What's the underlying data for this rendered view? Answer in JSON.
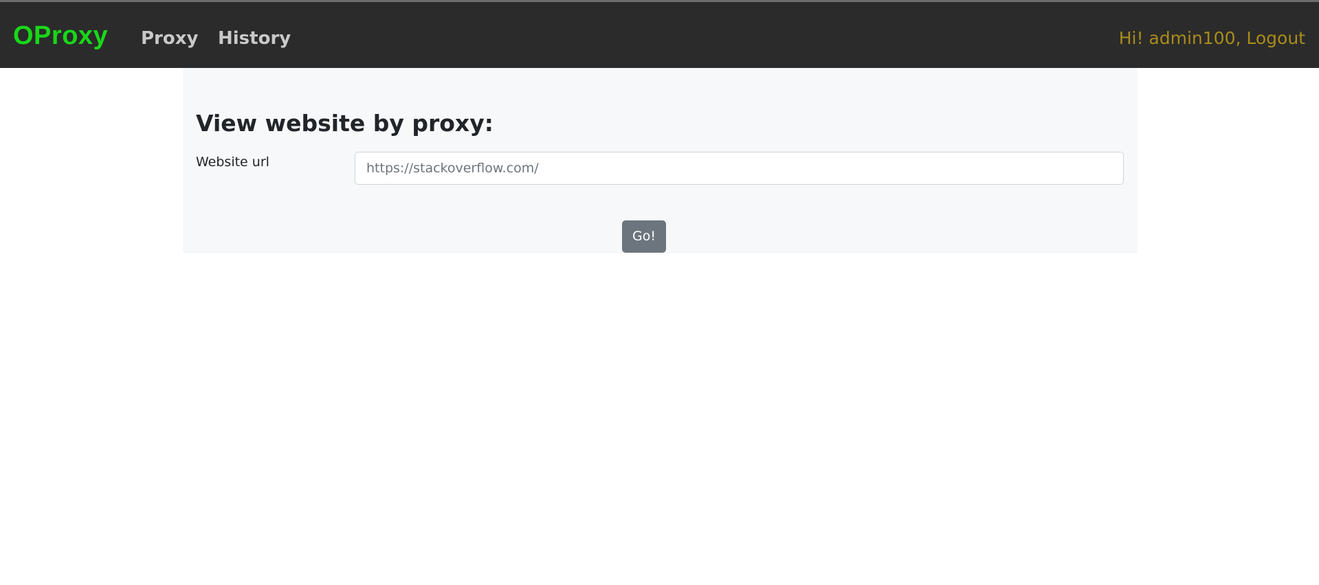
{
  "navbar": {
    "brand": "OProxy",
    "links": [
      {
        "label": "Proxy"
      },
      {
        "label": "History"
      }
    ],
    "greeting": "Hi! admin100,",
    "logout_label": "Logout",
    "colors": {
      "background": "#2b2b2b",
      "brand": "#18d818",
      "link": "#c9c9c9",
      "user": "#a98c1a"
    }
  },
  "main": {
    "title": "View website by proxy:",
    "url_label": "Website url",
    "url_placeholder": "https://stackoverflow.com/",
    "url_value": "",
    "submit_label": "Go!"
  }
}
